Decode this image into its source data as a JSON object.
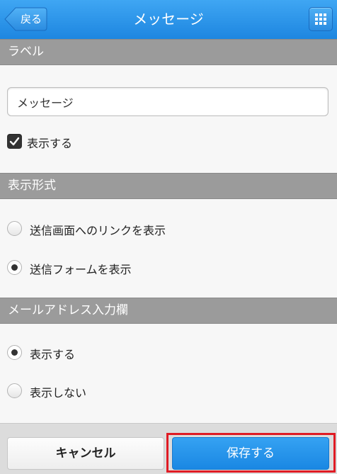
{
  "header": {
    "back_label": "戻る",
    "title": "メッセージ",
    "grid_icon": "grid-icon"
  },
  "sections": {
    "label": {
      "heading": "ラベル",
      "input_value": "メッセージ",
      "show_checkbox_label": "表示する",
      "show_checked": true
    },
    "display_format": {
      "heading": "表示形式",
      "options": [
        "送信画面へのリンクを表示",
        "送信フォームを表示"
      ],
      "selected_index": 1
    },
    "email_field": {
      "heading": "メールアドレス入力欄",
      "options": [
        "表示する",
        "表示しない"
      ],
      "selected_index": 0
    }
  },
  "footer": {
    "cancel_label": "キャンセル",
    "save_label": "保存する"
  },
  "colors": {
    "header_blue": "#1d86e0",
    "section_gray": "#9b9b9b",
    "highlight_red": "#e01b24"
  }
}
